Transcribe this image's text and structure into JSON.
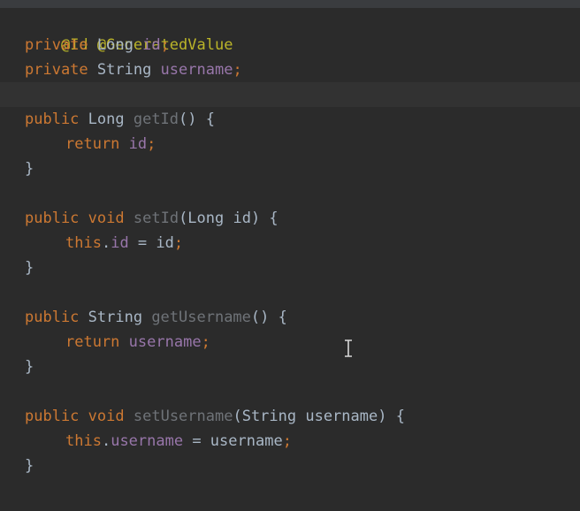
{
  "editor": {
    "language": "Java",
    "cursor_icon": "text-cursor-icon",
    "lines": [
      [
        {
          "t": "@Id",
          "c": "anno"
        },
        {
          "t": " ",
          "c": "plain"
        },
        {
          "t": "@GeneratedValue",
          "c": "anno"
        }
      ],
      [
        {
          "t": "private",
          "c": "kw"
        },
        {
          "t": " Long ",
          "c": "plain"
        },
        {
          "t": "id",
          "c": "field"
        },
        {
          "t": ";",
          "c": "punct"
        }
      ],
      [
        {
          "t": "private",
          "c": "kw"
        },
        {
          "t": " String ",
          "c": "plain"
        },
        {
          "t": "username",
          "c": "field"
        },
        {
          "t": ";",
          "c": "punct"
        }
      ],
      [],
      [
        {
          "t": "public",
          "c": "kw"
        },
        {
          "t": " Long ",
          "c": "plain"
        },
        {
          "t": "getId",
          "c": "method"
        },
        {
          "t": "() {",
          "c": "plain"
        }
      ],
      [
        {
          "t": "return",
          "c": "kw"
        },
        {
          "t": " ",
          "c": "plain"
        },
        {
          "t": "id",
          "c": "field"
        },
        {
          "t": ";",
          "c": "punct"
        }
      ],
      [
        {
          "t": "}",
          "c": "plain"
        }
      ],
      [],
      [
        {
          "t": "public",
          "c": "kw"
        },
        {
          "t": " ",
          "c": "plain"
        },
        {
          "t": "void",
          "c": "kw"
        },
        {
          "t": " ",
          "c": "plain"
        },
        {
          "t": "setId",
          "c": "method"
        },
        {
          "t": "(Long id) {",
          "c": "plain"
        }
      ],
      [
        {
          "t": "this",
          "c": "kw"
        },
        {
          "t": ".",
          "c": "plain"
        },
        {
          "t": "id",
          "c": "field"
        },
        {
          "t": " = id",
          "c": "plain"
        },
        {
          "t": ";",
          "c": "punct"
        }
      ],
      [
        {
          "t": "}",
          "c": "plain"
        }
      ],
      [],
      [
        {
          "t": "public",
          "c": "kw"
        },
        {
          "t": " String ",
          "c": "plain"
        },
        {
          "t": "getUsername",
          "c": "method"
        },
        {
          "t": "() {",
          "c": "plain"
        }
      ],
      [
        {
          "t": "return",
          "c": "kw"
        },
        {
          "t": " ",
          "c": "plain"
        },
        {
          "t": "username",
          "c": "field"
        },
        {
          "t": ";",
          "c": "punct"
        }
      ],
      [
        {
          "t": "}",
          "c": "plain"
        }
      ],
      [],
      [
        {
          "t": "public",
          "c": "kw"
        },
        {
          "t": " ",
          "c": "plain"
        },
        {
          "t": "void",
          "c": "kw"
        },
        {
          "t": " ",
          "c": "plain"
        },
        {
          "t": "setUsername",
          "c": "method"
        },
        {
          "t": "(String username) {",
          "c": "plain"
        }
      ],
      [
        {
          "t": "this",
          "c": "kw"
        },
        {
          "t": ".",
          "c": "plain"
        },
        {
          "t": "username",
          "c": "field"
        },
        {
          "t": " = username",
          "c": "plain"
        },
        {
          "t": ";",
          "c": "punct"
        }
      ],
      [
        {
          "t": "}",
          "c": "plain"
        }
      ]
    ]
  },
  "colors": {
    "background": "#2b2b2b",
    "current_line": "#323232",
    "annotation": "#bbb529",
    "keyword": "#cc7832",
    "field": "#9876aa",
    "method": "#6f7378",
    "plain": "#a9b7c6"
  }
}
